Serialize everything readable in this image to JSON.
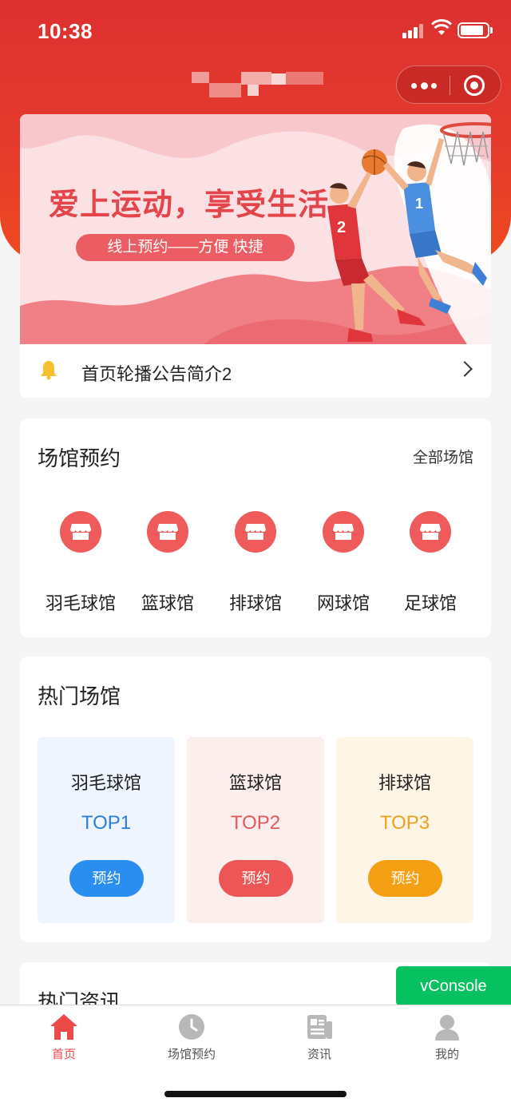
{
  "status_bar": {
    "time": "10:38"
  },
  "capsule": {
    "more_icon": "more-dots-icon",
    "close_icon": "target-icon"
  },
  "banner": {
    "headline": "爱上运动，享受生活",
    "pill_text": "线上预约——方便 快捷",
    "jersey_left": "2",
    "jersey_right": "1"
  },
  "notice": {
    "text": "首页轮播公告简介2",
    "icon": "bell-icon"
  },
  "venues": {
    "title": "场馆预约",
    "link": "全部场馆",
    "items": [
      {
        "label": "羽毛球馆",
        "icon": "shop-icon"
      },
      {
        "label": "篮球馆",
        "icon": "shop-icon"
      },
      {
        "label": "排球馆",
        "icon": "shop-icon"
      },
      {
        "label": "网球馆",
        "icon": "shop-icon"
      },
      {
        "label": "足球馆",
        "icon": "shop-icon"
      }
    ]
  },
  "hot": {
    "title": "热门场馆",
    "items": [
      {
        "name": "羽毛球馆",
        "rank": "TOP1",
        "button": "预约",
        "color": "#2a8df0",
        "bg": "#eef5ff"
      },
      {
        "name": "篮球馆",
        "rank": "TOP2",
        "button": "预约",
        "color": "#ee5656",
        "bg": "#fdeeee"
      },
      {
        "name": "排球馆",
        "rank": "TOP3",
        "button": "预约",
        "color": "#f5a012",
        "bg": "#fdf5e6"
      }
    ]
  },
  "news": {
    "title": "热门资讯"
  },
  "vconsole": {
    "label": "vConsole"
  },
  "tabbar": {
    "items": [
      {
        "label": "首页",
        "icon": "home-icon",
        "active": true
      },
      {
        "label": "场馆预约",
        "icon": "clock-icon",
        "active": false
      },
      {
        "label": "资讯",
        "icon": "news-icon",
        "active": false
      },
      {
        "label": "我的",
        "icon": "user-icon",
        "active": false
      }
    ]
  },
  "colors": {
    "brand_red": "#e03232",
    "accent_red": "#ee4a4a",
    "vconsole_green": "#07c160"
  }
}
